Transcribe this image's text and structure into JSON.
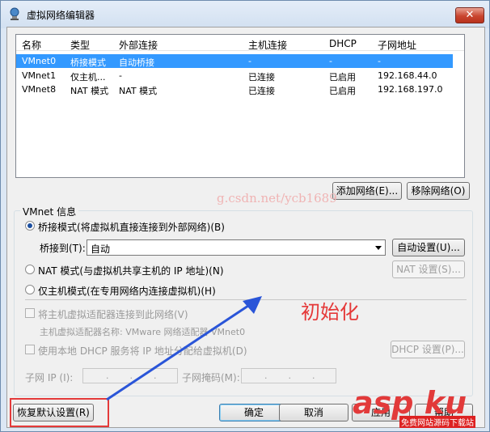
{
  "window": {
    "title": "虚拟网络编辑器",
    "close_label": "✕"
  },
  "table": {
    "headers": [
      "名称",
      "类型",
      "外部连接",
      "主机连接",
      "DHCP",
      "子网地址"
    ],
    "rows": [
      [
        "VMnet0",
        "桥接模式",
        "自动桥接",
        "-",
        "-",
        "-"
      ],
      [
        "VMnet1",
        "仅主机...",
        "-",
        "已连接",
        "已启用",
        "192.168.44.0"
      ],
      [
        "VMnet8",
        "NAT 模式",
        "NAT 模式",
        "已连接",
        "已启用",
        "192.168.197.0"
      ]
    ]
  },
  "buttons": {
    "add_network": "添加网络(E)...",
    "remove_network": "移除网络(O)",
    "auto_settings": "自动设置(U)...",
    "nat_settings": "NAT 设置(S)...",
    "dhcp_settings": "DHCP 设置(P)...",
    "restore_defaults": "恢复默认设置(R)",
    "ok": "确定",
    "cancel": "取消",
    "apply": "应用",
    "help": "帮助"
  },
  "vmnet_info": {
    "group_label": "VMnet 信息",
    "bridged": "桥接模式(将虚拟机直接连接到外部网络)(B)",
    "bridged_to_label": "桥接到(T):",
    "bridged_to_value": "自动",
    "nat": "NAT 模式(与虚拟机共享主机的 IP 地址)(N)",
    "host_only": "仅主机模式(在专用网络内连接虚拟机)(H)",
    "connect_adapter": "将主机虚拟适配器连接到此网络(V)",
    "adapter_name": "主机虚拟适配器名称: VMware 网络适配器 VMnet0",
    "use_dhcp": "使用本地 DHCP 服务将 IP 地址分配给虚拟机(D)",
    "subnet_ip_label": "子网 IP (I):",
    "subnet_mask_label": "子网掩码(M):",
    "ip_placeholder": "...",
    "selected_mode": "bridged"
  },
  "overlay": {
    "watermark": "g.csdn.net/ycb1689",
    "annotation": "初始化",
    "logo_main": "asp ku",
    "logo_sub": "免费网站源码下载站"
  },
  "colors": {
    "selection": "#3399ff",
    "annotation": "#e53838"
  }
}
